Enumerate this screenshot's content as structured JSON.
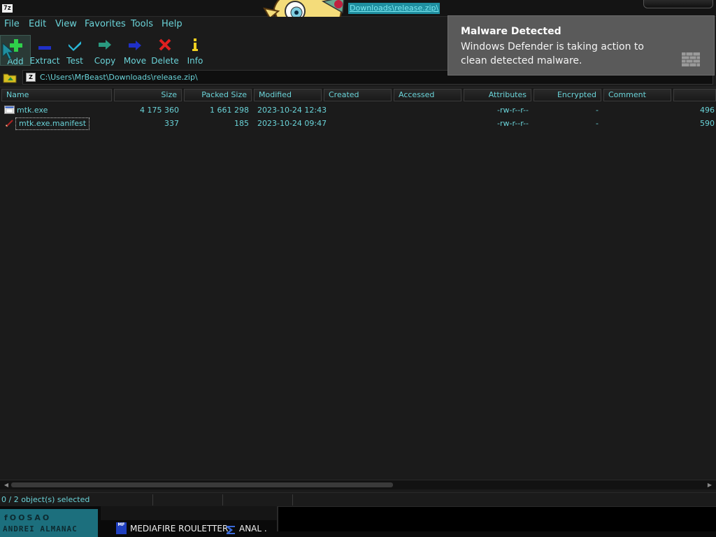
{
  "window": {
    "app_icon_text": "7z",
    "title": "Downloads\\release.zip\\"
  },
  "menu": [
    "File",
    "Edit",
    "View",
    "Favorites",
    "Tools",
    "Help"
  ],
  "toolbar": {
    "add": "Add",
    "extract": "Extract",
    "test": "Test",
    "copy": "Copy",
    "move": "Move",
    "delete": "Delete",
    "info": "Info"
  },
  "address": {
    "path": "C:\\Users\\MrBeast\\Downloads\\release.zip\\",
    "icon_text": "Z"
  },
  "columns": [
    "Name",
    "Size",
    "Packed Size",
    "Modified",
    "Created",
    "Accessed",
    "Attributes",
    "Encrypted",
    "Comment"
  ],
  "files": [
    {
      "name": "mtk.exe",
      "size": "4 175 360",
      "packed": "1 661 298",
      "modified": "2023-10-24 12:43",
      "attributes": "-rw-r--r--",
      "encrypted": "-",
      "crc": "496"
    },
    {
      "name": "mtk.exe.manifest",
      "size": "337",
      "packed": "185",
      "modified": "2023-10-24 09:47",
      "attributes": "-rw-r--r--",
      "encrypted": "-",
      "crc": "590"
    }
  ],
  "status": {
    "selection": "0 / 2 object(s) selected"
  },
  "taskbar": {
    "social_icons": "fOOSAO",
    "brand": "ANDREI ALMANAC",
    "item1_icon": "MF",
    "item1": "MEDIAFIRE ROULETTER",
    "item2": "ANAL ."
  },
  "toast": {
    "title": "Malware Detected",
    "message": "Windows Defender is taking action to clean detected malware."
  },
  "colors": {
    "text": "#6ad3d8",
    "background": "#1b1b1b",
    "toast_bg": "#5a5a5a",
    "title_highlight": "#1f8fa0"
  }
}
